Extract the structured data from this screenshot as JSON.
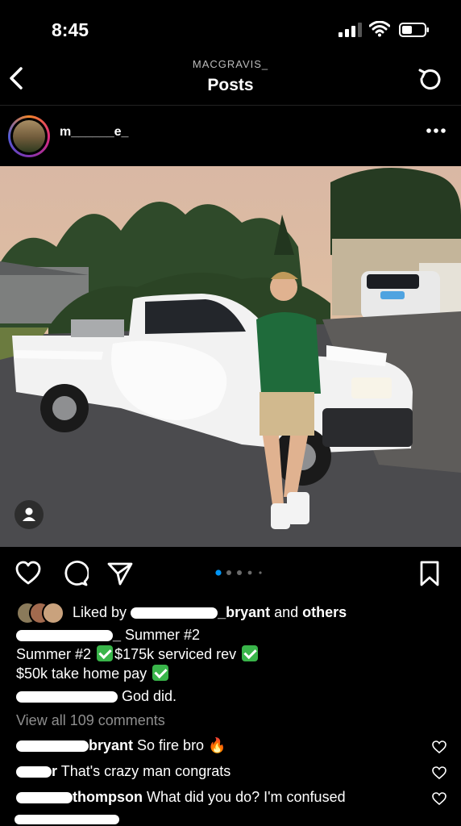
{
  "status_bar": {
    "time": "8:45"
  },
  "nav": {
    "username": "MACGRAVIS_",
    "title": "Posts"
  },
  "post": {
    "author": "m______e_",
    "image": "photo of young man in green polo shirt leaning on white pickup truck in driveway",
    "carousel": {
      "count": 5,
      "active": 0
    },
    "likes": {
      "prefix": "Liked by",
      "user": "_bryant",
      "mid": " and ",
      "others": "others"
    },
    "caption": {
      "line1_user": "_",
      "line1": "Summer #2",
      "line2_a": "Summer #2",
      "line2_b": "$175k serviced rev",
      "line3": "$50k take home pay",
      "line4": "God did."
    },
    "view_all": "View all 109 comments",
    "comments": [
      {
        "user": "bryant",
        "text": "So fire bro",
        "emoji": "🔥"
      },
      {
        "user": "r",
        "text": "That's crazy man congrats"
      },
      {
        "user": "thompson",
        "text": "What did you do? I'm confused"
      }
    ]
  },
  "colors": {
    "background": "#000000",
    "text": "#ffffff",
    "muted": "#8e8e8e",
    "active_dot": "#0095f6",
    "check": "#39b54a"
  }
}
